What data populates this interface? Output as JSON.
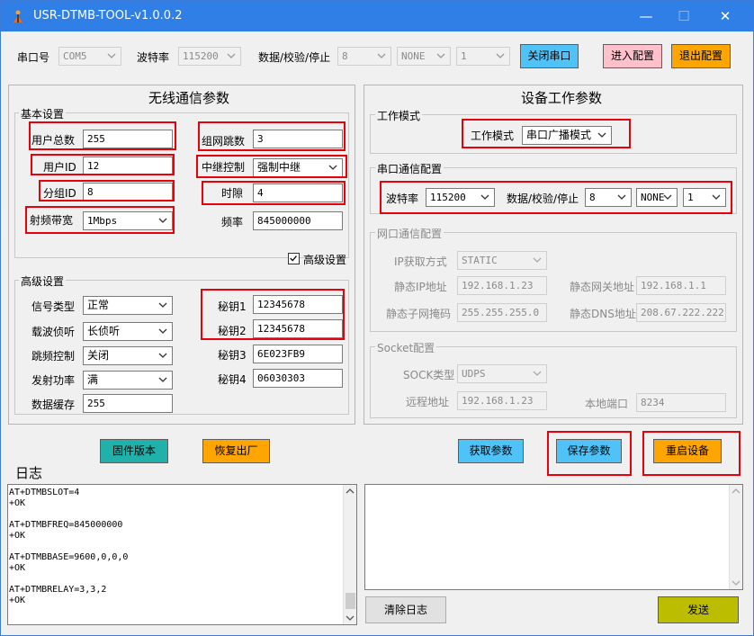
{
  "window": {
    "title": "USR-DTMB-TOOL-v1.0.0.2",
    "min": "—",
    "max": "☐",
    "close": "✕"
  },
  "toolbar": {
    "port_label": "串口号",
    "port_value": "COM5",
    "baud_label": "波特率",
    "baud_value": "115200",
    "data_label": "数据/校验/停止",
    "data_bits": "8",
    "parity": "NONE",
    "stop_bits": "1",
    "close_port": "关闭串口",
    "enter_config": "进入配置",
    "exit_config": "退出配置"
  },
  "left": {
    "title": "无线通信参数",
    "basic_label": "基本设置",
    "user_total_label": "用户总数",
    "user_total": "255",
    "user_id_label": "用户ID",
    "user_id": "12",
    "group_id_label": "分组ID",
    "group_id": "8",
    "bandwidth_label": "射频带宽",
    "bandwidth": "1Mbps",
    "hops_label": "组网跳数",
    "hops": "3",
    "relay_label": "中继控制",
    "relay": "强制中继",
    "slot_label": "时隙",
    "slot": "4",
    "freq_label": "频率",
    "freq": "845000000",
    "advanced_check_label": "高级设置",
    "advanced_label": "高级设置",
    "signal_label": "信号类型",
    "signal": "正常",
    "carrier_label": "载波侦听",
    "carrier": "长侦听",
    "hopping_label": "跳频控制",
    "hopping": "关闭",
    "power_label": "发射功率",
    "power": "满",
    "cache_label": "数据缓存",
    "cache": "255",
    "key1_label": "秘钥1",
    "key1": "12345678",
    "key2_label": "秘钥2",
    "key2": "12345678",
    "key3_label": "秘钥3",
    "key3": "6E023FB9",
    "key4_label": "秘钥4",
    "key4": "06030303"
  },
  "right": {
    "title": "设备工作参数",
    "work_mode_group": "工作模式",
    "work_mode_label": "工作模式",
    "work_mode": "串口广播模式",
    "serial_group": "串口通信配置",
    "baud_label": "波特率",
    "baud": "115200",
    "data_label": "数据/校验/停止",
    "data_bits": "8",
    "parity": "NONE",
    "stop_bits": "1",
    "net_group": "网口通信配置",
    "ip_mode_label": "IP获取方式",
    "ip_mode": "STATIC",
    "ip_label": "静态IP地址",
    "ip": "192.168.1.23",
    "gateway_label": "静态网关地址",
    "gateway": "192.168.1.1",
    "mask_label": "静态子网掩码",
    "mask": "255.255.255.0",
    "dns_label": "静态DNS地址",
    "dns": "208.67.222.222",
    "socket_group": "Socket配置",
    "sock_type_label": "SOCK类型",
    "sock_type": "UDPS",
    "remote_label": "远程地址",
    "remote": "192.168.1.23",
    "local_port_label": "本地端口",
    "local_port": "8234"
  },
  "actions": {
    "firmware": "固件版本",
    "factory_reset": "恢复出厂",
    "get_params": "获取参数",
    "save_params": "保存参数",
    "restart": "重启设备"
  },
  "log": {
    "title": "日志",
    "lines": [
      "AT+DTMBSLOT=4",
      "+OK",
      "",
      "AT+DTMBFREQ=845000000",
      "+OK",
      "",
      "AT+DTMBBASE=9600,0,0,0",
      "+OK",
      "",
      "AT+DTMBRELAY=3,3,2",
      "+OK"
    ],
    "clear": "清除日志",
    "send": "发送"
  },
  "colors": {
    "titlebar": "#2f7fe6",
    "highlight": "#e8000b",
    "btn_blue": "#4fc3f7",
    "btn_pink": "#ffc0cb",
    "btn_orange": "#ffa500",
    "btn_teal": "#20b2aa",
    "btn_send": "#bdbd00"
  }
}
